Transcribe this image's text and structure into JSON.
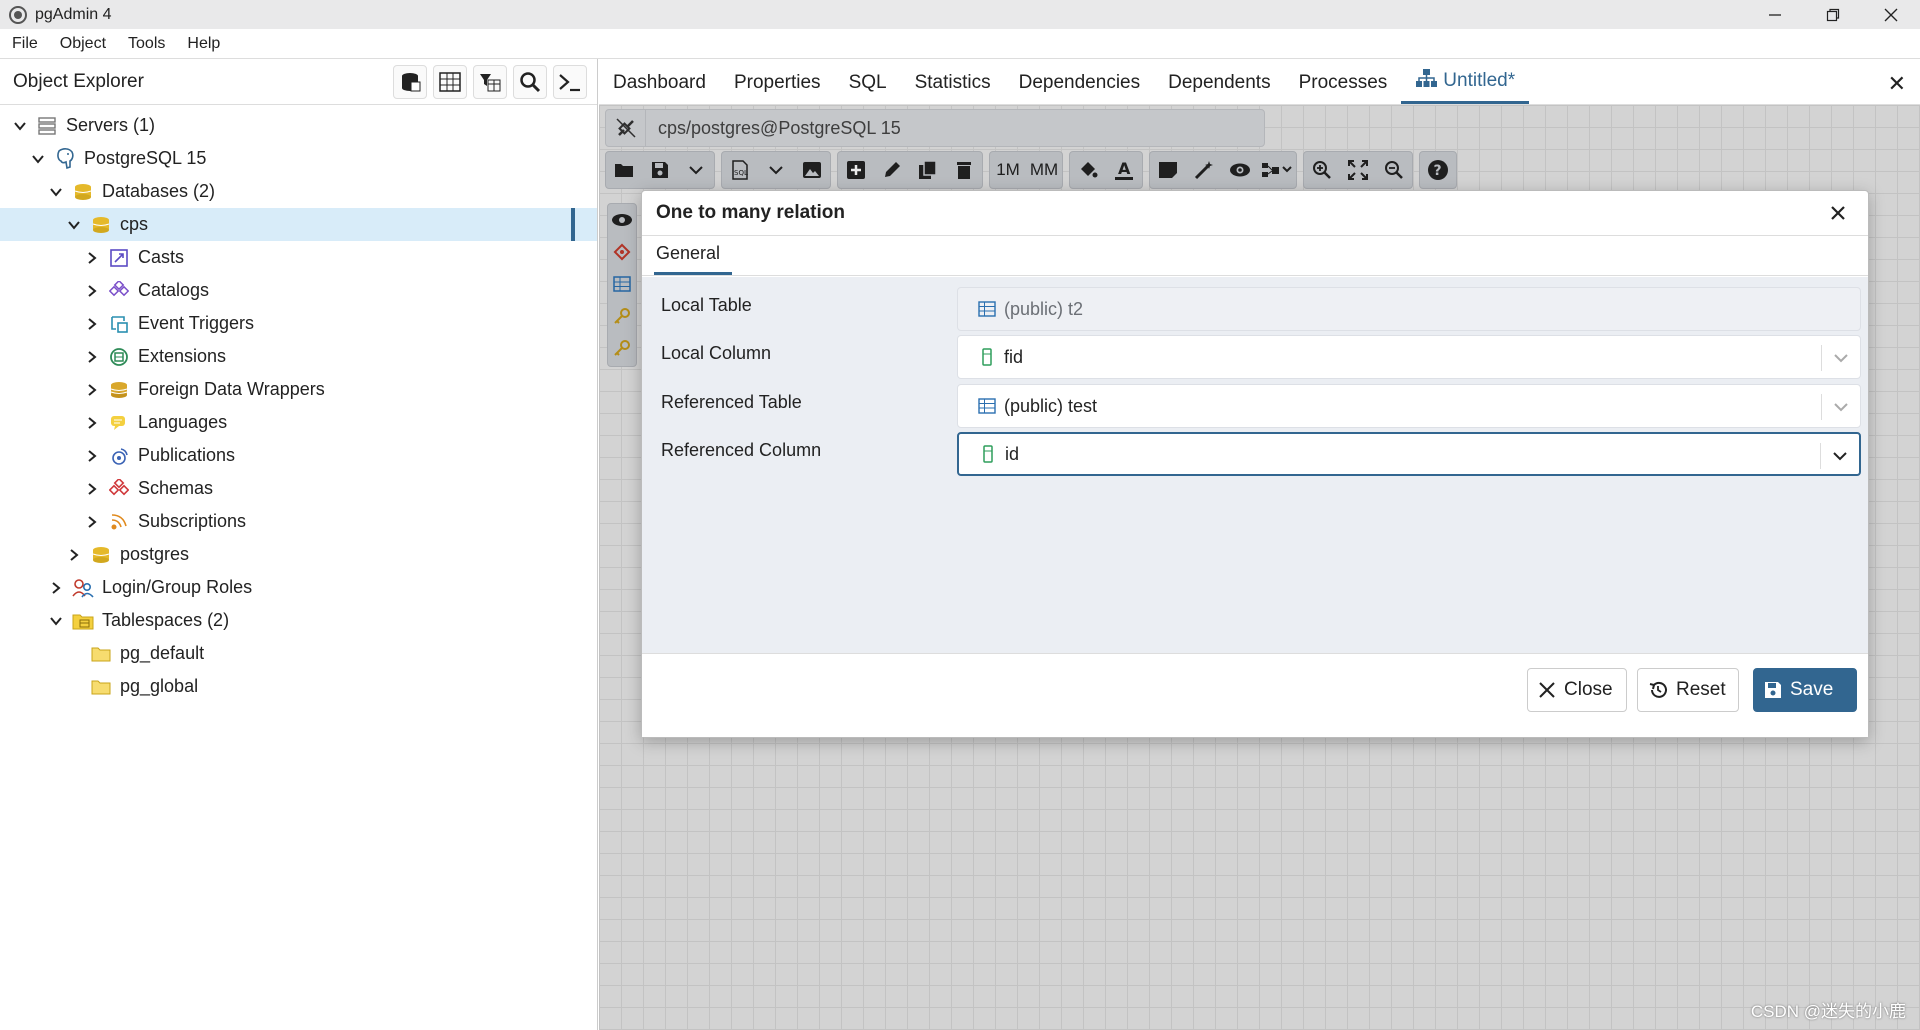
{
  "window": {
    "title": "pgAdmin 4"
  },
  "menu": [
    "File",
    "Object",
    "Tools",
    "Help"
  ],
  "object_explorer": {
    "title": "Object Explorer",
    "tree": [
      {
        "label": "Servers (1)",
        "level": 0,
        "expanded": true,
        "icon": "servers-icon"
      },
      {
        "label": "PostgreSQL 15",
        "level": 1,
        "expanded": true,
        "icon": "postgresql-elephant-icon"
      },
      {
        "label": "Databases (2)",
        "level": 2,
        "expanded": true,
        "icon": "databases-icon"
      },
      {
        "label": "cps",
        "level": 3,
        "expanded": true,
        "icon": "database-icon",
        "selected": true
      },
      {
        "label": "Casts",
        "level": 4,
        "expanded": false,
        "icon": "casts-icon"
      },
      {
        "label": "Catalogs",
        "level": 4,
        "expanded": false,
        "icon": "catalogs-icon"
      },
      {
        "label": "Event Triggers",
        "level": 4,
        "expanded": false,
        "icon": "event-triggers-icon"
      },
      {
        "label": "Extensions",
        "level": 4,
        "expanded": false,
        "icon": "extensions-icon"
      },
      {
        "label": "Foreign Data Wrappers",
        "level": 4,
        "expanded": false,
        "icon": "foreign-data-wrappers-icon"
      },
      {
        "label": "Languages",
        "level": 4,
        "expanded": false,
        "icon": "languages-icon"
      },
      {
        "label": "Publications",
        "level": 4,
        "expanded": false,
        "icon": "publications-icon"
      },
      {
        "label": "Schemas",
        "level": 4,
        "expanded": false,
        "icon": "schemas-icon"
      },
      {
        "label": "Subscriptions",
        "level": 4,
        "expanded": false,
        "icon": "subscriptions-icon"
      },
      {
        "label": "postgres",
        "level": 3,
        "expanded": false,
        "icon": "database-icon"
      },
      {
        "label": "Login/Group Roles",
        "level": 2,
        "expanded": false,
        "icon": "roles-icon"
      },
      {
        "label": "Tablespaces (2)",
        "level": 2,
        "expanded": true,
        "icon": "tablespaces-icon"
      },
      {
        "label": "pg_default",
        "level": 3,
        "leaf": true,
        "icon": "folder-icon"
      },
      {
        "label": "pg_global",
        "level": 3,
        "leaf": true,
        "icon": "folder-icon"
      }
    ]
  },
  "tabs": [
    {
      "label": "Dashboard"
    },
    {
      "label": "Properties"
    },
    {
      "label": "SQL"
    },
    {
      "label": "Statistics"
    },
    {
      "label": "Dependencies"
    },
    {
      "label": "Dependents"
    },
    {
      "label": "Processes"
    },
    {
      "label": "Untitled*",
      "active": true
    }
  ],
  "erd": {
    "connection": "cps/postgres@PostgreSQL 15",
    "toolbar_text": {
      "one_to_many": "1M",
      "many_to_many": "MM"
    }
  },
  "dialog": {
    "title": "One to many relation",
    "tab": "General",
    "fields": [
      {
        "label": "Local Table",
        "value": "(public) t2",
        "icon": "table-icon",
        "disabled": true
      },
      {
        "label": "Local Column",
        "value": "fid",
        "icon": "column-icon",
        "dropdown": true
      },
      {
        "label": "Referenced Table",
        "value": "(public) test",
        "icon": "table-icon",
        "dropdown": true
      },
      {
        "label": "Referenced Column",
        "value": "id",
        "icon": "column-icon",
        "dropdown": true,
        "focused": true
      }
    ],
    "buttons": {
      "close": "Close",
      "reset": "Reset",
      "save": "Save"
    }
  },
  "watermark": "CSDN @迷失的小鹿",
  "colors": {
    "accent": "#326690",
    "selected_row": "#d8ecf9"
  }
}
